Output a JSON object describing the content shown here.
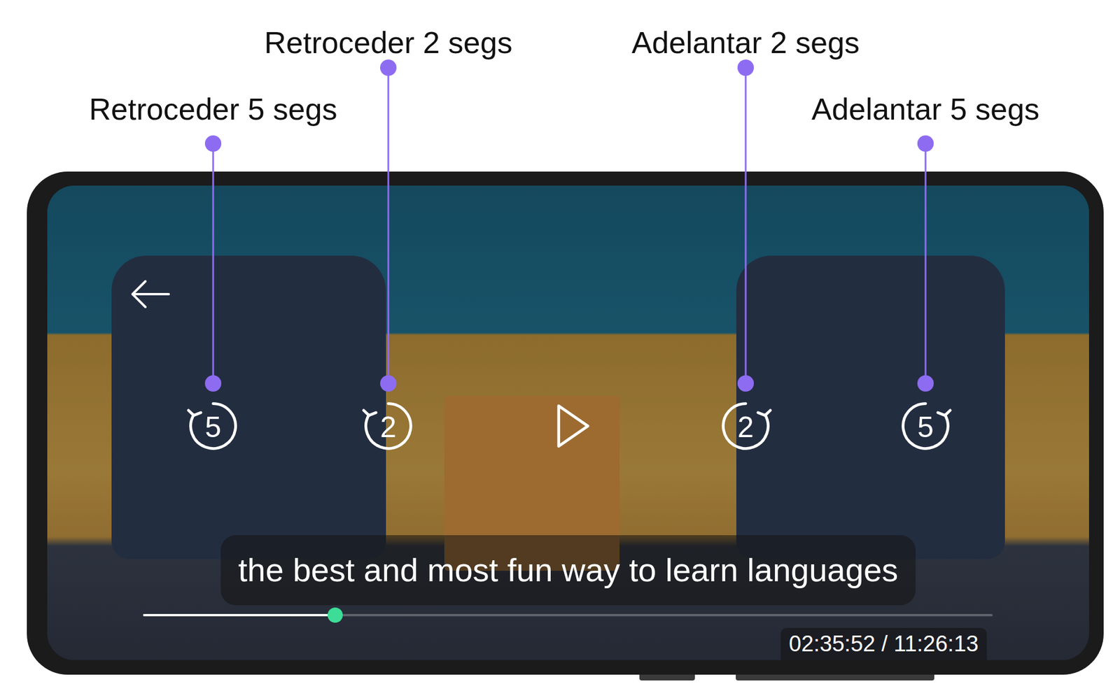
{
  "controls": [
    {
      "kind": "rewind",
      "number": "5",
      "annotation": "Retroceder 5 segs"
    },
    {
      "kind": "rewind",
      "number": "2",
      "annotation": "Retroceder 2 segs"
    },
    {
      "kind": "play"
    },
    {
      "kind": "forward",
      "number": "2",
      "annotation": "Adelantar 2 segs"
    },
    {
      "kind": "forward",
      "number": "5",
      "annotation": "Adelantar 5 segs"
    }
  ],
  "subtitle": "the best and most fun way to learn languages",
  "progress": {
    "level": 0.226
  },
  "time": "02:35:52 / 11:26:13"
}
